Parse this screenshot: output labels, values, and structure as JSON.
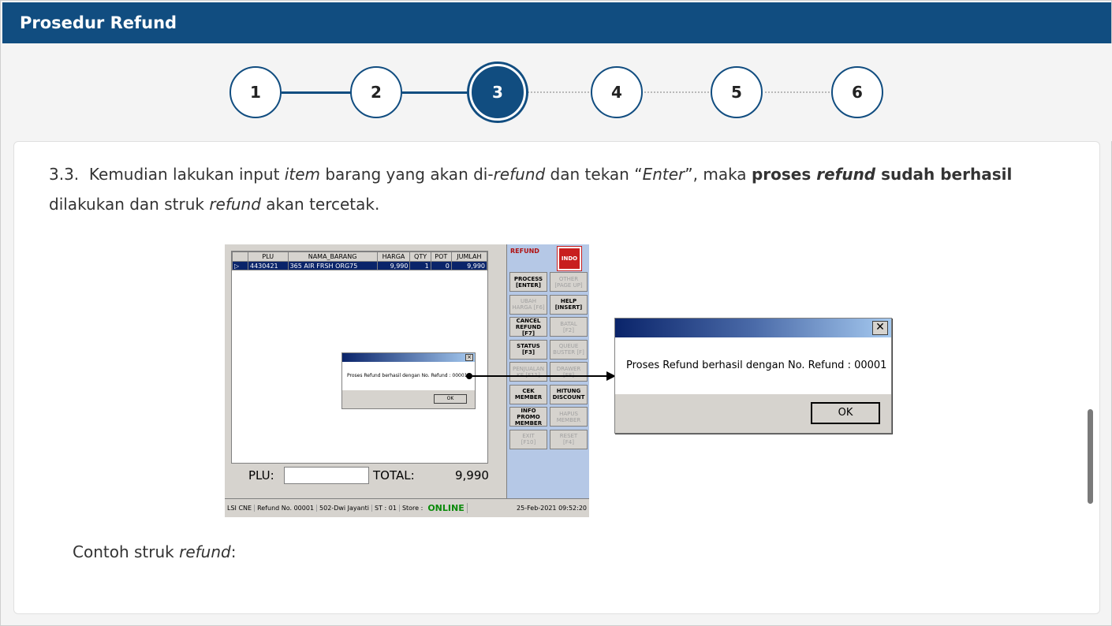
{
  "header": {
    "title": "Prosedur Refund"
  },
  "stepper": {
    "steps": [
      "1",
      "2",
      "3",
      "4",
      "5",
      "6"
    ],
    "active": "3"
  },
  "content": {
    "number": "3.3.",
    "p1": "Kemudian lakukan input ",
    "p1_item": "item",
    "p2": " barang yang akan di-",
    "p2_refund": "refund",
    "p3": " dan tekan “",
    "p3_enter": "Enter",
    "p4": "”, maka ",
    "p4_bold1": "proses ",
    "p4_refund": "refund",
    "p4_bold2": " sudah berhasil",
    "p5": "dilakukan dan struk ",
    "p5_refund": "refund",
    "p6": " akan tercetak.",
    "caption_a": "Contoh struk ",
    "caption_b": "refund",
    "caption_c": ":"
  },
  "pos": {
    "columns": [
      "",
      "PLU",
      "NAMA_BARANG",
      "HARGA",
      "QTY",
      "POT",
      "JUMLAH"
    ],
    "row": [
      "▷",
      "4430421",
      "365 AIR FRSH ORG75",
      "9,990",
      "1",
      "0",
      "9,990"
    ],
    "plu_label": "PLU:",
    "total_label": "TOTAL:",
    "total_value": "9,990",
    "panel_title": "REFUND",
    "logo_text": "INDO",
    "buttons": [
      {
        "l1": "PROCESS",
        "l2": "[ENTER]"
      },
      {
        "l1": "OTHER",
        "l2": "[PAGE UP]"
      },
      {
        "l1": "UBAH",
        "l2": "HARGA [F6]"
      },
      {
        "l1": "HELP",
        "l2": "[INSERT]"
      },
      {
        "l1": "CANCEL",
        "l2": "REFUND [F7]"
      },
      {
        "l1": "BATAL",
        "l2": "[F2]"
      },
      {
        "l1": "STATUS",
        "l2": "[F3]"
      },
      {
        "l1": "QUEUE",
        "l2": "BUSTER [F]"
      },
      {
        "l1": "PENJUALAN",
        "l2": "KE [F11]"
      },
      {
        "l1": "DRAWER",
        "l2": "[F8]"
      },
      {
        "l1": "CEK",
        "l2": "MEMBER"
      },
      {
        "l1": "HITUNG",
        "l2": "DISCOUNT"
      },
      {
        "l1": "INFO PROMO",
        "l2": "MEMBER"
      },
      {
        "l1": "HAPUS",
        "l2": "MEMBER"
      },
      {
        "l1": "EXIT",
        "l2": "[F10]"
      },
      {
        "l1": "RESET",
        "l2": "[F4]"
      }
    ],
    "status": {
      "s1": "LSI CNE",
      "s2": "Refund No. 00001",
      "s3": "502-Dwi Jayanti",
      "s4": "ST : 01",
      "s5": "Store :",
      "online": "ONLINE",
      "datetime": "25-Feb-2021 09:52:20"
    },
    "mini_dialog": {
      "message": "Proses Refund berhasil dengan No. Refund : 00001",
      "ok": "OK",
      "close": "×"
    }
  },
  "dialog": {
    "message": "Proses Refund berhasil dengan No. Refund : 00001",
    "ok_label": "OK",
    "close": "✕"
  }
}
